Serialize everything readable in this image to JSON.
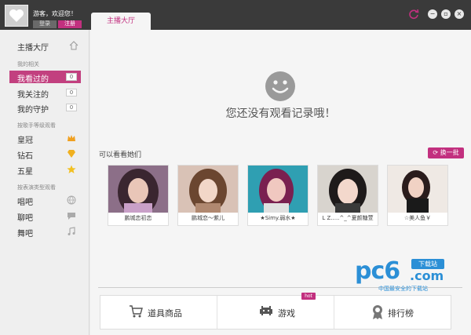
{
  "titlebar": {
    "welcome": "游客，欢迎您！",
    "login_label": "登录",
    "register_label": "注册",
    "tab_label": "主播大厅",
    "refresh_icon": "refresh-icon",
    "min_label": "−",
    "restore_label": "▫",
    "close_label": "×"
  },
  "sidebar": {
    "home_label": "主播大厅",
    "section_mine": "我的相关",
    "items_mine": [
      {
        "label": "我看过的",
        "count": "0"
      },
      {
        "label": "我关注的",
        "count": "0"
      },
      {
        "label": "我的守护",
        "count": "0"
      }
    ],
    "section_level": "按歌手等级观看",
    "items_level": [
      {
        "label": "皇冠",
        "icon": "crown-icon"
      },
      {
        "label": "钻石",
        "icon": "diamond-icon"
      },
      {
        "label": "五星",
        "icon": "star-icon"
      }
    ],
    "section_type": "按表演类型观看",
    "items_type": [
      {
        "label": "唱吧",
        "icon": "globe-icon"
      },
      {
        "label": "聊吧",
        "icon": "chat-icon"
      },
      {
        "label": "舞吧",
        "icon": "music-icon"
      }
    ]
  },
  "main": {
    "empty_text": "您还没有观看记录哦！",
    "watch_title": "可以看看她们",
    "change_label": "换一批",
    "anchors": [
      {
        "name": "鹏城恋初恋"
      },
      {
        "name": "鹏城恋～紫儿"
      },
      {
        "name": "★Simy.弱水★"
      },
      {
        "name": "L Z.....^_^夏颜糖萱"
      },
      {
        "name": "☆美人鱼￥"
      }
    ],
    "bottom": {
      "props_label": "道具商品",
      "games_label": "游戏",
      "hot_label": "hot",
      "rank_label": "排行榜"
    }
  },
  "watermark": {
    "big": "pc6",
    "tag": "下载站",
    "com": ".com",
    "sub": "中国最安全的下载站"
  },
  "colors": {
    "accent": "#c2307f",
    "titlebar": "#3a3a3a",
    "watermark": "#2b8fd6"
  }
}
